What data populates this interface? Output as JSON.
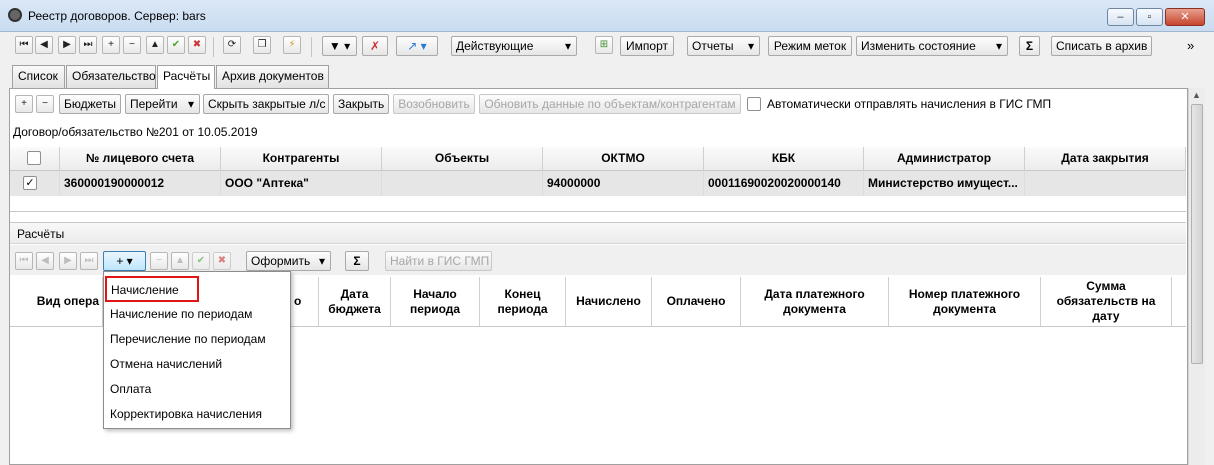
{
  "window": {
    "title": "Реестр договоров. Сервер: bars"
  },
  "toolbar": {
    "status_filter": "Действующие",
    "import_label": "Импорт",
    "reports_label": "Отчеты",
    "mark_mode_label": "Режим меток",
    "change_state_label": "Изменить состояние",
    "sigma": "Σ",
    "archive_label": "Списать в архив",
    "more": "»"
  },
  "tabs": [
    "Список",
    "Обязательство",
    "Расчёты",
    "Архив документов"
  ],
  "subtoolbar": {
    "budgets": "Бюджеты",
    "goto": "Перейти",
    "hide_closed": "Скрыть закрытые л/с",
    "close": "Закрыть",
    "resume": "Возобновить",
    "refresh": "Обновить данные по объектам/контрагентам",
    "auto_send": "Автоматически отправлять начисления в ГИС ГМП"
  },
  "contract_caption": "Договор/обязательство №201 от 10.05.2019",
  "accounts_table": {
    "columns": [
      "№ лицевого счета",
      "Контрагенты",
      "Объекты",
      "ОКТМО",
      "КБК",
      "Администратор",
      "Дата закрытия"
    ],
    "rows": [
      {
        "checked": "✓",
        "account": "360000190000012",
        "counterparty": "ООО \"Аптека\"",
        "objects": "",
        "oktmo": "94000000",
        "kbk": "00011690020020000140",
        "admin": "Министерство имущест...",
        "close_date": ""
      }
    ]
  },
  "settlements": {
    "caption": "Расчёты",
    "format_label": "Оформить",
    "find_gis": "Найти в ГИС ГМП",
    "columns": [
      "Вид опера",
      "о",
      "Дата бюджета",
      "Начало периода",
      "Конец периода",
      "Начислено",
      "Оплачено",
      "Дата платежного документа",
      "Номер платежного документа",
      "Сумма обязательств на дату"
    ]
  },
  "add_menu": {
    "items": [
      "Начисление",
      "Начисление по периодам",
      "Перечисление по периодам",
      "Отмена начислений",
      "Оплата",
      "Корректировка начисления"
    ]
  }
}
